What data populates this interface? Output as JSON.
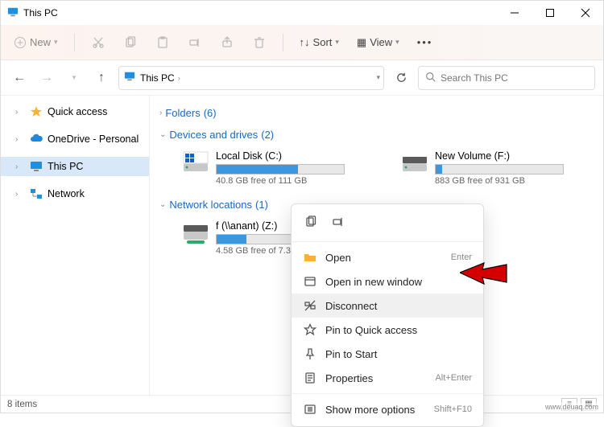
{
  "window": {
    "title": "This PC"
  },
  "commandbar": {
    "new_label": "New",
    "sort_label": "Sort",
    "view_label": "View"
  },
  "nav": {
    "crumb": "This PC",
    "search_placeholder": "Search This PC"
  },
  "sidebar": {
    "items": [
      {
        "label": "Quick access",
        "icon": "star"
      },
      {
        "label": "OneDrive - Personal",
        "icon": "cloud"
      },
      {
        "label": "This PC",
        "icon": "pc",
        "selected": true
      },
      {
        "label": "Network",
        "icon": "network"
      }
    ]
  },
  "sections": {
    "folders": {
      "label": "Folders",
      "count": 6
    },
    "devices": {
      "label": "Devices and drives",
      "count": 2
    },
    "network": {
      "label": "Network locations",
      "count": 1
    }
  },
  "drives": {
    "local": {
      "name": "Local Disk (C:)",
      "free": "40.8 GB free of 111 GB",
      "fillPct": 64
    },
    "newvol": {
      "name": "New Volume (F:)",
      "free": "883 GB free of 931 GB",
      "fillPct": 5
    },
    "net": {
      "name": "f (\\\\anant) (Z:)",
      "free": "4.58 GB free of 7.38",
      "fillPct": 38
    }
  },
  "contextmenu": {
    "open": "Open",
    "open_hint": "Enter",
    "open_new": "Open in new window",
    "disconnect": "Disconnect",
    "pin_quick": "Pin to Quick access",
    "pin_start": "Pin to Start",
    "properties": "Properties",
    "properties_hint": "Alt+Enter",
    "more": "Show more options",
    "more_hint": "Shift+F10"
  },
  "statusbar": {
    "count": "8 items"
  },
  "watermark": "www.deuaq.com"
}
